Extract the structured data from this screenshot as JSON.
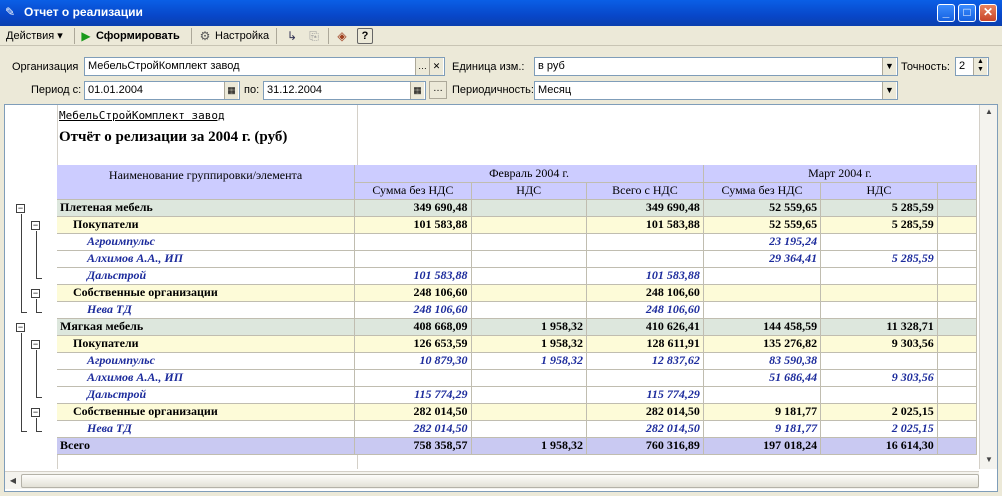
{
  "window": {
    "title": "Отчет о реализации"
  },
  "toolbar": {
    "actions_label": "Действия",
    "generate_label": "Сформировать",
    "settings_label": "Настройка"
  },
  "filters": {
    "org_label": "Организация",
    "org_value": "МебельСтройКомплект завод",
    "unit_label": "Единица изм.:",
    "unit_value": "в руб",
    "precision_label": "Точность:",
    "precision_value": "2",
    "period_from_label": "Период с:",
    "period_from_value": "01.01.2004",
    "period_to_label": "по:",
    "period_to_value": "31.12.2004",
    "periodicity_label": "Периодичность:",
    "periodicity_value": "Месяц"
  },
  "report": {
    "org_name": "МебельСтройКомплект завод",
    "title": "Отчёт о релизации за 2004 г. (руб)",
    "group_header": "Наименование группировки/элемента",
    "months": [
      "Февраль 2004 г.",
      "Март 2004 г."
    ],
    "subcols": [
      "Сумма без НДС",
      "НДС",
      "Всего с НДС"
    ],
    "rows": [
      {
        "level": 0,
        "name": "Плетеная мебель",
        "f1": "349 690,48",
        "f2": "",
        "f3": "349 690,48",
        "m1": "52 559,65",
        "m2": "5 285,59"
      },
      {
        "level": 1,
        "name": "Покупатели",
        "f1": "101 583,88",
        "f2": "",
        "f3": "101 583,88",
        "m1": "52 559,65",
        "m2": "5 285,59"
      },
      {
        "level": 2,
        "name": "Агроимпульс",
        "f1": "",
        "f2": "",
        "f3": "",
        "m1": "23 195,24",
        "m2": ""
      },
      {
        "level": 2,
        "name": "Алхимов А.А., ИП",
        "f1": "",
        "f2": "",
        "f3": "",
        "m1": "29 364,41",
        "m2": "5 285,59"
      },
      {
        "level": 2,
        "name": "Дальстрой",
        "f1": "101 583,88",
        "f2": "",
        "f3": "101 583,88",
        "m1": "",
        "m2": ""
      },
      {
        "level": 1,
        "name": "Собственные организации",
        "f1": "248 106,60",
        "f2": "",
        "f3": "248 106,60",
        "m1": "",
        "m2": ""
      },
      {
        "level": 2,
        "name": "Нева ТД",
        "f1": "248 106,60",
        "f2": "",
        "f3": "248 106,60",
        "m1": "",
        "m2": ""
      },
      {
        "level": 0,
        "name": "Мягкая мебель",
        "f1": "408 668,09",
        "f2": "1 958,32",
        "f3": "410 626,41",
        "m1": "144 458,59",
        "m2": "11 328,71"
      },
      {
        "level": 1,
        "name": "Покупатели",
        "f1": "126 653,59",
        "f2": "1 958,32",
        "f3": "128 611,91",
        "m1": "135 276,82",
        "m2": "9 303,56"
      },
      {
        "level": 2,
        "name": "Агроимпульс",
        "f1": "10 879,30",
        "f2": "1 958,32",
        "f3": "12 837,62",
        "m1": "83 590,38",
        "m2": ""
      },
      {
        "level": 2,
        "name": "Алхимов А.А., ИП",
        "f1": "",
        "f2": "",
        "f3": "",
        "m1": "51 686,44",
        "m2": "9 303,56"
      },
      {
        "level": 2,
        "name": "Дальстрой",
        "f1": "115 774,29",
        "f2": "",
        "f3": "115 774,29",
        "m1": "",
        "m2": ""
      },
      {
        "level": 1,
        "name": "Собственные организации",
        "f1": "282 014,50",
        "f2": "",
        "f3": "282 014,50",
        "m1": "9 181,77",
        "m2": "2 025,15"
      },
      {
        "level": 2,
        "name": "Нева ТД",
        "f1": "282 014,50",
        "f2": "",
        "f3": "282 014,50",
        "m1": "9 181,77",
        "m2": "2 025,15"
      },
      {
        "level": 3,
        "name": "Всего",
        "f1": "758 358,57",
        "f2": "1 958,32",
        "f3": "760 316,89",
        "m1": "197 018,24",
        "m2": "16 614,30"
      }
    ]
  }
}
